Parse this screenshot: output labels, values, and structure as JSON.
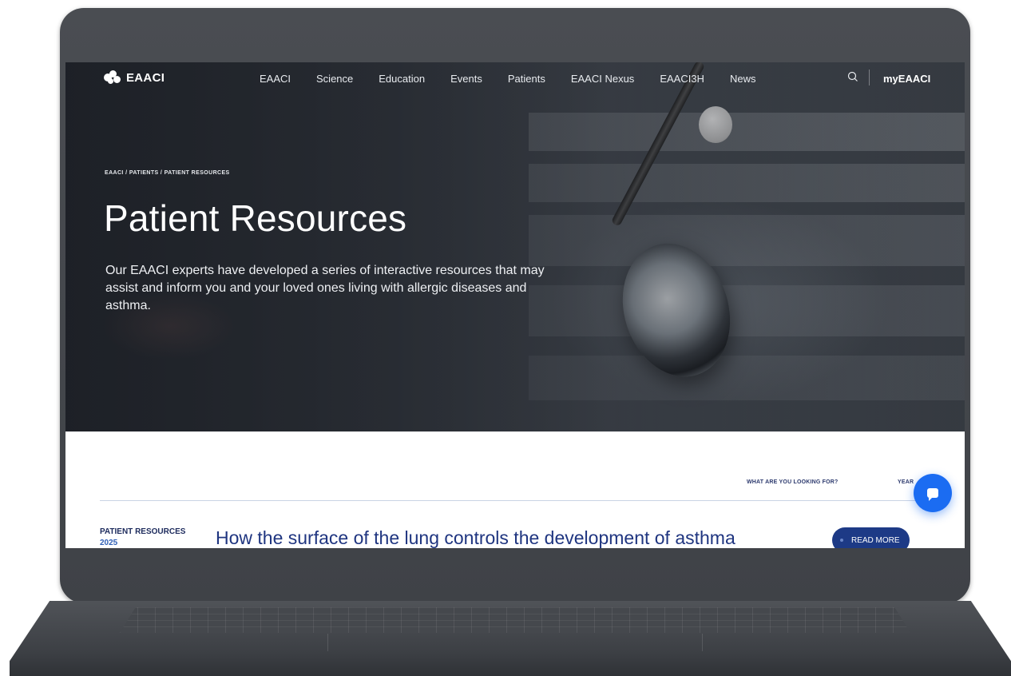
{
  "nav": {
    "logo": "EAACI",
    "links": [
      "EAACI",
      "Science",
      "Education",
      "Events",
      "Patients",
      "EAACI Nexus",
      "EAACI3H",
      "News"
    ],
    "account": "myEAACI",
    "search_icon": "search-icon"
  },
  "hero": {
    "breadcrumb": "EAACI / PATIENTS / PATIENT RESOURCES",
    "title": "Patient Resources",
    "intro": "Our EAACI experts have developed a series of interactive resources that may assist and inform you and your loved ones living with allergic diseases and asthma."
  },
  "filters": {
    "search_label": "WHAT ARE YOU LOOKING FOR?",
    "year_label": "YEAR"
  },
  "resources": [
    {
      "category": "PATIENT RESOURCES",
      "year": "2025",
      "title": "How the surface of the lung controls the development of asthma",
      "cta": "READ MORE"
    }
  ],
  "chat": {
    "icon": "chat-icon"
  },
  "colors": {
    "brand_navy": "#1d3a86",
    "link_blue": "#1f3580",
    "chat_blue": "#1b6cf2"
  }
}
